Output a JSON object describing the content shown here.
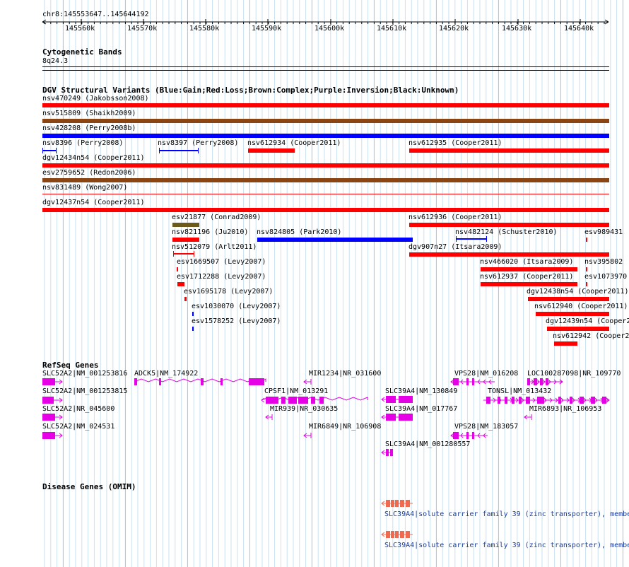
{
  "location": "chr8:145553647..145644192",
  "ruler_ticks": [
    "145560k",
    "145570k",
    "145580k",
    "145590k",
    "145600k",
    "145610k",
    "145620k",
    "145630k",
    "145640k"
  ],
  "tracks": {
    "cytoband": {
      "title": "Cytogenetic Bands",
      "band": "8q24.3"
    },
    "dgv": {
      "title": "DGV Structural Variants (Blue:Gain;Red:Loss;Brown:Complex;Purple:Inversion;Black:Unknown)",
      "colors": {
        "gain": "#0000ff",
        "loss": "#ff0000",
        "complex": "#8b4513",
        "inversion": "#800080",
        "unknown": "#000000",
        "complex_olive": "#6b5a1a"
      },
      "features": [
        {
          "label": "nsv470249 (Jakobsson2008)",
          "type": "loss"
        },
        {
          "label": "nsv515809 (Shaikh2009)",
          "type": "complex"
        },
        {
          "label": "nsv428208 (Perry2008b)",
          "type": "gain"
        },
        {
          "label": "nsv8396 (Perry2008)",
          "type": "gain"
        },
        {
          "label": "nsv8397 (Perry2008)",
          "type": "gain"
        },
        {
          "label": "nsv612934 (Cooper2011)",
          "type": "loss"
        },
        {
          "label": "nsv612935 (Cooper2011)",
          "type": "loss"
        },
        {
          "label": "dgv12434n54 (Cooper2011)",
          "type": "loss"
        },
        {
          "label": "esv2759652 (Redon2006)",
          "type": "complex"
        },
        {
          "label": "nsv831489 (Wong2007)",
          "type": "loss"
        },
        {
          "label": "dgv12437n54 (Cooper2011)",
          "type": "loss"
        },
        {
          "label": "esv21877 (Conrad2009)",
          "type": "complex"
        },
        {
          "label": "nsv612936 (Cooper2011)",
          "type": "loss"
        },
        {
          "label": "nsv821196 (Ju2010)",
          "type": "loss"
        },
        {
          "label": "nsv824805 (Park2010)",
          "type": "gain"
        },
        {
          "label": "nsv482124 (Schuster2010)",
          "type": "gain"
        },
        {
          "label": "esv989431",
          "type": "loss"
        },
        {
          "label": "nsv512079 (Arlt2011)",
          "type": "loss"
        },
        {
          "label": "dgv907n27 (Itsara2009)",
          "type": "loss"
        },
        {
          "label": "esv1669507 (Levy2007)",
          "type": "loss"
        },
        {
          "label": "nsv466020 (Itsara2009)",
          "type": "loss"
        },
        {
          "label": "nsv395802",
          "type": "loss"
        },
        {
          "label": "esv1712288 (Levy2007)",
          "type": "loss"
        },
        {
          "label": "nsv612937 (Cooper2011)",
          "type": "loss"
        },
        {
          "label": "esv1073970",
          "type": "loss"
        },
        {
          "label": "esv1695178 (Levy2007)",
          "type": "loss"
        },
        {
          "label": "dgv12438n54 (Cooper2011)",
          "type": "loss"
        },
        {
          "label": "esv1030070 (Levy2007)",
          "type": "gain"
        },
        {
          "label": "nsv612940 (Cooper2011)",
          "type": "loss"
        },
        {
          "label": "esv1578252 (Levy2007)",
          "type": "gain"
        },
        {
          "label": "dgv12439n54 (Cooper2",
          "type": "loss"
        },
        {
          "label": "nsv612942 (Cooper2",
          "type": "loss"
        }
      ]
    },
    "refseq": {
      "title": "RefSeq Genes",
      "color": "#e600e6",
      "genes": [
        {
          "label": "SLC52A2|NM_001253816"
        },
        {
          "label": "ADCK5|NM_174922"
        },
        {
          "label": "MIR1234|NR_031600"
        },
        {
          "label": "VPS28|NM_016208"
        },
        {
          "label": "LOC100287098|NR_109770"
        },
        {
          "label": "SLC52A2|NM_001253815"
        },
        {
          "label": "CPSF1|NM_013291"
        },
        {
          "label": "SLC39A4|NM_130849"
        },
        {
          "label": "TONSL|NM_013432"
        },
        {
          "label": "SLC52A2|NR_045600"
        },
        {
          "label": "MIR939|NR_030635"
        },
        {
          "label": "SLC39A4|NM_017767"
        },
        {
          "label": "MIR6893|NR_106953"
        },
        {
          "label": "SLC52A2|NM_024531"
        },
        {
          "label": "MIR6849|NR_106908"
        },
        {
          "label": "VPS28|NM_183057"
        },
        {
          "label": "SLC39A4|NM_001280557"
        }
      ]
    },
    "omim": {
      "title": "Disease Genes (OMIM)",
      "color": "#f06a50",
      "entries": [
        {
          "label": "SLC39A4|solute carrier family 39 (zinc transporter), membe"
        },
        {
          "label": "SLC39A4|solute carrier family 39 (zinc transporter), membe"
        }
      ]
    }
  }
}
